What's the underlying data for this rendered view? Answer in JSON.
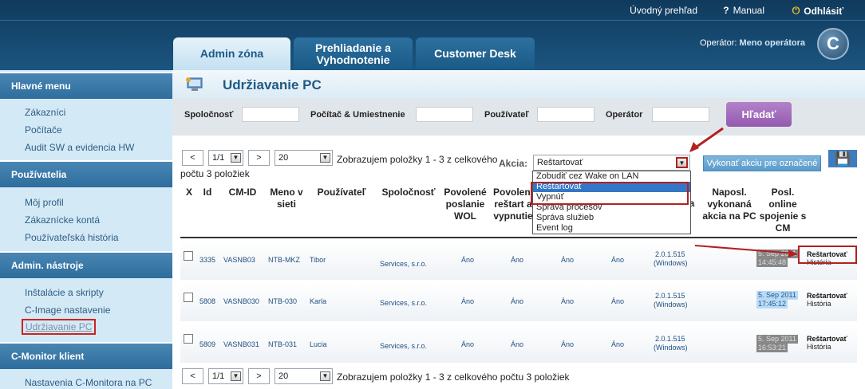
{
  "header": {
    "home": "Úvodný prehľad",
    "manual": "Manual",
    "logout": "Odhlásiť",
    "operator_label": "Operátor:",
    "operator_name": "Meno operátora",
    "logo_letter": "C"
  },
  "tabs": [
    "Admin zóna",
    "Prehliadanie a Vyhodnotenie",
    "Customer Desk"
  ],
  "sidebar": {
    "sections": [
      {
        "title": "Hlavné menu",
        "items": [
          "Zákazníci",
          "Počítače",
          "Audit SW a evidencia HW"
        ]
      },
      {
        "title": "Používatelia",
        "items": [
          "Môj profil",
          "Zákaznícke kontá",
          "Používateľská história"
        ]
      },
      {
        "title": "Admin. nástroje",
        "items": [
          "Inštalácie a skripty",
          "C-Image nastavenie",
          "Udržiavanie PC"
        ]
      },
      {
        "title": "C-Monitor klient",
        "items": [
          "Nastavenia C-Monitora na PC"
        ]
      }
    ]
  },
  "page": {
    "title": "Udržiavanie PC"
  },
  "filters": {
    "company": "Spoločnosť",
    "computer": "Počítač & Umiestnenie",
    "user": "Používateľ",
    "operator": "Operátor",
    "search_button": "Hľadať"
  },
  "pager": {
    "prev": "<",
    "page": "1/1",
    "next": ">",
    "page_size": "20",
    "info_top_1": "Zobrazujem položky 1 - 3 z celkového",
    "info_top_2": "počtu 3 položiek",
    "info_bottom": "Zobrazujem položky 1 - 3 z celkového počtu 3 položiek"
  },
  "actions": {
    "label": "Akcia:",
    "selected": "Reštartovať",
    "options": [
      "Zobudiť cez Wake on LAN",
      "Reštartovať",
      "Vypnúť",
      "Správa procesov",
      "Správa služieb",
      "Event log"
    ],
    "execute_button": "Vykonať akciu pre označené"
  },
  "table": {
    "headers": [
      "X",
      "Id",
      "CM-ID",
      "Meno v sieti",
      "Používateľ",
      "Spoločnosť",
      "Povolené poslanie WOL",
      "Povolený reštart a vypnutie",
      "",
      "",
      "a",
      "Naposl. vykonaná akcia na PC",
      "Posl. online spojenie s CM"
    ],
    "rows": [
      {
        "id": "3335",
        "cmid": "VASNB03",
        "name": "NTB-MKZ",
        "user": "Tibor",
        "company": "Services, s.r.o.",
        "wol": "Áno",
        "restart": "Áno",
        "c1": "Áno",
        "c2": "Áno",
        "version": "2.0.1.515",
        "os": "(Windows)",
        "last_action": "",
        "date": "5. Sep 2011",
        "time": "14:45:48",
        "act1": "Reštartovať",
        "act2": "História"
      },
      {
        "id": "5808",
        "cmid": "VASNB030",
        "name": "NTB-030",
        "user": "Karla",
        "company": "Services, s.r.o.",
        "wol": "Áno",
        "restart": "Áno",
        "c1": "Áno",
        "c2": "Áno",
        "version": "2.0.1.515",
        "os": "(Windows)",
        "last_action": "",
        "date": "5. Sep 2011",
        "time": "17:45:12",
        "act1": "Reštartovať",
        "act2": "História"
      },
      {
        "id": "5809",
        "cmid": "VASNB031",
        "name": "NTB-031",
        "user": "Lucia",
        "company": "Services, s.r.o.",
        "wol": "Áno",
        "restart": "Áno",
        "c1": "Áno",
        "c2": "Áno",
        "version": "2.0.1.515",
        "os": "(Windows)",
        "last_action": "",
        "date": "5. Sep 2011",
        "time": "16:53:21",
        "act1": "Reštartovať",
        "act2": "História"
      }
    ]
  }
}
